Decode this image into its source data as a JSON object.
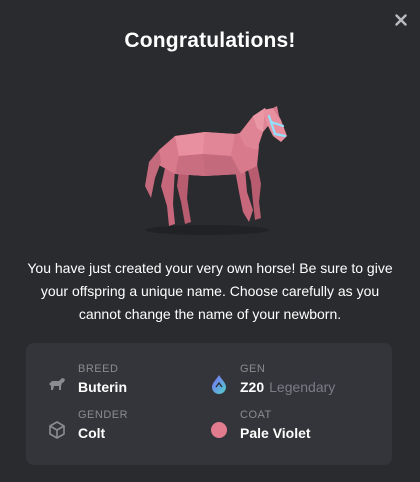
{
  "modal": {
    "title": "Congratulations!",
    "message": "You have just created your very own horse! Be sure to give your offspring a unique name. Choose carefully as you cannot change the name of your newborn."
  },
  "attributes": {
    "breed": {
      "label": "BREED",
      "value": "Buterin",
      "icon": "horse-icon"
    },
    "gen": {
      "label": "GEN",
      "value": "Z20",
      "rarity": "Legendary",
      "icon": "gen-drop-icon"
    },
    "gender": {
      "label": "GENDER",
      "value": "Colt",
      "icon": "cube-icon"
    },
    "coat": {
      "label": "COAT",
      "value": "Pale Violet",
      "icon": "coat-swatch-icon",
      "color": "#e07c8e"
    }
  },
  "colors": {
    "background": "#2a2b2f",
    "card": "#34353a",
    "horse": "#d97a8c",
    "bridle": "#8fe3ff"
  }
}
